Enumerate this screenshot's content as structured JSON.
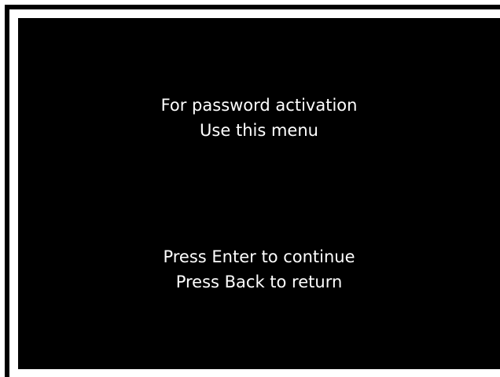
{
  "screen": {
    "title_lines": [
      "For password activation",
      "Use this menu"
    ],
    "instruction_lines": [
      "Press Enter to continue",
      "Press Back to return"
    ]
  },
  "colors": {
    "background": "#000000",
    "text": "#ffffff",
    "frame": "#000000",
    "page": "#ffffff"
  }
}
